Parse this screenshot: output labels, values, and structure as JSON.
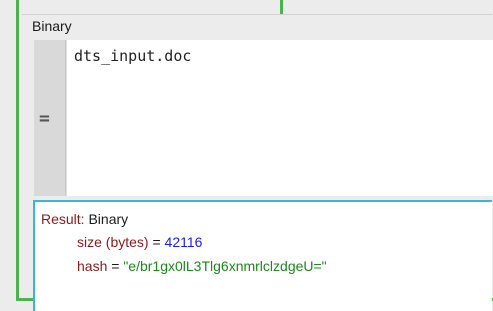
{
  "header": {
    "title": "Binary"
  },
  "editor": {
    "gutter_marker": "=",
    "code": "dts_input.doc"
  },
  "result": {
    "label": "Result:",
    "type": "Binary",
    "fields": [
      {
        "name": "size (bytes)",
        "operator": " = ",
        "value": "42116"
      },
      {
        "name": "hash",
        "operator": " = ",
        "value": "\"e/br1gx0lL3Tlg6xnmrlclzdgeU=\""
      }
    ]
  },
  "colors": {
    "green_border": "#4cb34c",
    "result_border": "#36b6e0",
    "field_name": "#8b1a1a",
    "number": "#1a1aff",
    "string": "#1a8a1a"
  }
}
